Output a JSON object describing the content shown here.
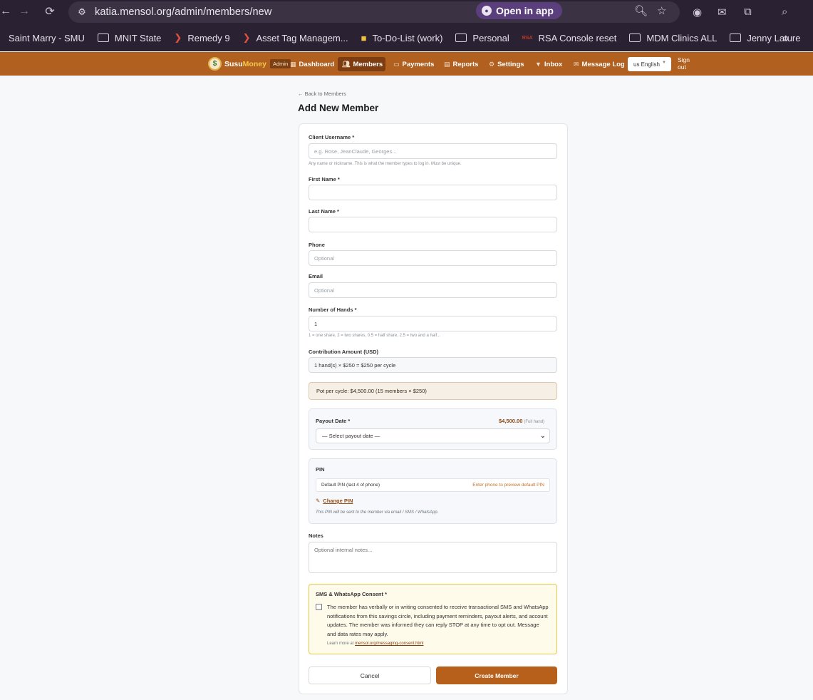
{
  "browser": {
    "url": "katia.mensol.org/admin/members/new",
    "open_in_app": "Open in app",
    "bookmarks": [
      {
        "label": "Saint Marry - SMU",
        "icon": "folder-icon"
      },
      {
        "label": "MNIT State",
        "icon": "folder-icon"
      },
      {
        "label": "Remedy 9",
        "icon": "remedy-icon"
      },
      {
        "label": "Asset Tag Managem...",
        "icon": "remedy-icon"
      },
      {
        "label": "To-Do-List (work)",
        "icon": "bulb-icon"
      },
      {
        "label": "Personal",
        "icon": "folder-icon"
      },
      {
        "label": "RSA Console reset",
        "icon": "rsa-icon"
      },
      {
        "label": "MDM Clinics ALL",
        "icon": "folder-icon"
      },
      {
        "label": "Jenny Lature",
        "icon": "folder-icon"
      }
    ]
  },
  "nav": {
    "brand_a": "Susu",
    "brand_b": "Money",
    "admin_badge": "Admin",
    "items": [
      {
        "label": "Dashboard"
      },
      {
        "label": "Members"
      },
      {
        "label": "Payments"
      },
      {
        "label": "Reports"
      },
      {
        "label": "Settings"
      },
      {
        "label": "Inbox"
      },
      {
        "label": "Message Log"
      }
    ],
    "language": "us English",
    "sign_out": "Sign out"
  },
  "page": {
    "back_link": "← Back to Members",
    "title": "Add New Member"
  },
  "form": {
    "username_label": "Client Username *",
    "username_placeholder": "e.g. Rose, JeanClaude, Georges...",
    "username_hint": "Any name or nickname. This is what the member types to log in. Must be unique.",
    "first_name_label": "First Name *",
    "last_name_label": "Last Name *",
    "phone_label": "Phone",
    "phone_placeholder": "Optional",
    "email_label": "Email",
    "email_placeholder": "Optional",
    "hands_label": "Number of Hands *",
    "hands_value": "1",
    "hands_hint": "1 = one share, 2 = two shares, 0.5 = half share, 2.5 = two and a half...",
    "contribution_label": "Contribution Amount (USD)",
    "contribution_value": "1 hand(s) × $250 = $250 per cycle",
    "pot_text": "Pot per cycle: $4,500.00 (15 members × $250)",
    "payout_label": "Payout Date *",
    "payout_amount": "$4,500.00",
    "payout_amount_note": "(Full hand)",
    "payout_select": "— Select payout date —",
    "pin_label": "PIN",
    "pin_default": "Default PIN (last 4 of phone)",
    "pin_hint": "Enter phone to preview default PIN",
    "change_pin": "Change PIN",
    "pin_note": "This PIN will be sent to the member via email / SMS / WhatsApp.",
    "notes_label": "Notes",
    "notes_placeholder": "Optional internal notes...",
    "consent_title": "SMS & WhatsApp Consent *",
    "consent_text": "The member has verbally or in writing consented to receive transactional SMS and WhatsApp notifications from this savings circle, including payment reminders, payout alerts, and account updates. The member was informed they can reply STOP at any time to opt out. Message and data rates may apply.",
    "consent_learn_prefix": "Learn more at",
    "consent_learn_link": "mensol.org/messaging-consent.html",
    "cancel": "Cancel",
    "create": "Create Member"
  }
}
